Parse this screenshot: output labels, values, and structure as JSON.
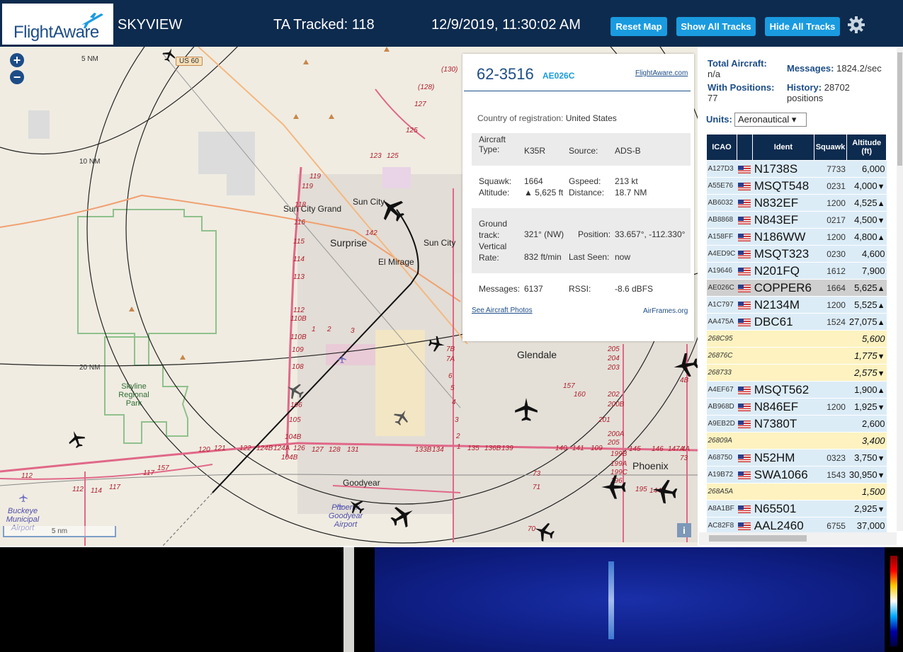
{
  "header": {
    "logo": "FlightAware",
    "app_name": "SKYVIEW",
    "tracked": "TA Tracked: 118",
    "datetime": "12/9/2019, 11:30:02 AM",
    "buttons": {
      "reset_map": "Reset Map",
      "show_all": "Show All Tracks",
      "hide_all": "Hide All Tracks"
    },
    "settings_icon": "gear-icon"
  },
  "map": {
    "zoom_in": "+",
    "zoom_out": "−",
    "range_rings": [
      "5 NM",
      "10 NM",
      "20 NM"
    ],
    "shield_us60": "US 60",
    "cities": [
      "Sun City Grand",
      "Sun City",
      "Surprise",
      "Sun City",
      "El Mirage",
      "Glendale",
      "Goodyear",
      "Phoenix"
    ],
    "park": "Skyline Regional Park",
    "airports": {
      "buckeye": "Buckeye Municipal Airport",
      "goodyear": "Phoenix Goodyear Airport"
    },
    "route_numbers": [
      "(130)",
      "(128)",
      "127",
      "125",
      "123",
      "125",
      "119",
      "119",
      "118",
      "116",
      "115",
      "114",
      "113",
      "112",
      "110B",
      "110B",
      "109",
      "108",
      "106",
      "105",
      "104B",
      "104B",
      "142",
      "1",
      "2",
      "3",
      "7B",
      "7A",
      "6",
      "5",
      "4",
      "3",
      "2",
      "1",
      "120",
      "121",
      "122",
      "124B",
      "124A",
      "126",
      "127",
      "128",
      "131",
      "133B",
      "134",
      "135",
      "136B",
      "139",
      "140",
      "141",
      "109",
      "112",
      "112",
      "114",
      "117",
      "117",
      "157",
      "157",
      "160",
      "201",
      "200A",
      "205",
      "205",
      "204",
      "203",
      "202",
      "200B",
      "199B",
      "199A",
      "199C",
      "196",
      "195",
      "144B",
      "145",
      "146",
      "147A",
      "4A",
      "4B",
      "73",
      "73",
      "71",
      "70"
    ],
    "scale": "5 nm",
    "info": "i"
  },
  "popup": {
    "registration": "62-3516",
    "icao": "AE026C",
    "link": "FlightAware.com",
    "country_label": "Country of registration:",
    "country_value": "United States",
    "aircraft_type_label_1": "Aircraft",
    "aircraft_type_label_2": "Type:",
    "aircraft_type_value": "K35R",
    "source_label": "Source:",
    "source_value": "ADS-B",
    "squawk_label": "Squawk:",
    "squawk_value": "1664",
    "gspeed_label": "Gspeed:",
    "gspeed_value": "213 kt",
    "altitude_label": "Altitude:",
    "altitude_value": "▲ 5,625 ft",
    "distance_label": "Distance:",
    "distance_value": "18.7 NM",
    "track_label_1": "Ground",
    "track_label_2": "track:",
    "track_value": "321° (NW)",
    "position_label": "Position:",
    "position_value": "33.657°, -112.330°",
    "vrate_label_1": "Vertical",
    "vrate_label_2": "Rate:",
    "vrate_value": "832 ft/min",
    "lastseen_label": "Last Seen:",
    "lastseen_value": "now",
    "messages_label": "Messages:",
    "messages_value": "6137",
    "rssi_label": "RSSI:",
    "rssi_value": "-8.6 dBFS",
    "photos_link": "See Aircraft Photos",
    "airframes_link": "AirFrames.org"
  },
  "panel": {
    "total_label": "Total Aircraft:",
    "total_value": "n/a",
    "messages_label": "Messages:",
    "messages_value": "1824.2/sec",
    "positions_label": "With Positions:",
    "positions_value": "77",
    "history_label": "History:",
    "history_value": "28702",
    "history_unit": "positions",
    "units_label": "Units:",
    "units_value": "Aeronautical ▾",
    "columns": [
      "ICAO",
      "",
      "Ident",
      "Squawk",
      "Altitude (ft)"
    ],
    "rows": [
      {
        "icao": "A127D3",
        "flag": true,
        "ident": "N1738S",
        "squawk": "7733",
        "alt": "6,000",
        "trend": "",
        "type": "adsb"
      },
      {
        "icao": "A55E76",
        "flag": true,
        "ident": "MSQT548",
        "squawk": "0231",
        "alt": "4,000",
        "trend": "▼",
        "type": "adsb"
      },
      {
        "icao": "AB6032",
        "flag": true,
        "ident": "N832EF",
        "squawk": "1200",
        "alt": "4,525",
        "trend": "▲",
        "type": "adsb"
      },
      {
        "icao": "AB8868",
        "flag": true,
        "ident": "N843EF",
        "squawk": "0217",
        "alt": "4,500",
        "trend": "▼",
        "type": "adsb"
      },
      {
        "icao": "A158FF",
        "flag": true,
        "ident": "N186WW",
        "squawk": "1200",
        "alt": "4,800",
        "trend": "▲",
        "type": "adsb"
      },
      {
        "icao": "A4ED9C",
        "flag": true,
        "ident": "MSQT323",
        "squawk": "0230",
        "alt": "4,600",
        "trend": "",
        "type": "adsb"
      },
      {
        "icao": "A19646",
        "flag": true,
        "ident": "N201FQ",
        "squawk": "1612",
        "alt": "7,900",
        "trend": "",
        "type": "adsb"
      },
      {
        "icao": "AE026C",
        "flag": true,
        "ident": "COPPER6",
        "squawk": "1664",
        "alt": "5,625",
        "trend": "▲",
        "type": "sel"
      },
      {
        "icao": "A1C797",
        "flag": true,
        "ident": "N2134M",
        "squawk": "1200",
        "alt": "5,525",
        "trend": "▲",
        "type": "adsb"
      },
      {
        "icao": "AA475A",
        "flag": true,
        "ident": "DBC61",
        "squawk": "1524",
        "alt": "27,075",
        "trend": "▲",
        "type": "adsb"
      },
      {
        "icao": "268C95",
        "flag": false,
        "ident": "",
        "squawk": "",
        "alt": "5,600",
        "trend": "",
        "type": "mlat"
      },
      {
        "icao": "26876C",
        "flag": false,
        "ident": "",
        "squawk": "",
        "alt": "1,775",
        "trend": "▼",
        "type": "mlat"
      },
      {
        "icao": "268733",
        "flag": false,
        "ident": "",
        "squawk": "",
        "alt": "2,575",
        "trend": "▼",
        "type": "mlat"
      },
      {
        "icao": "A4EF67",
        "flag": true,
        "ident": "MSQT562",
        "squawk": "",
        "alt": "1,900",
        "trend": "▲",
        "type": "adsb"
      },
      {
        "icao": "AB968D",
        "flag": true,
        "ident": "N846EF",
        "squawk": "1200",
        "alt": "1,925",
        "trend": "▼",
        "type": "adsb"
      },
      {
        "icao": "A9EB2D",
        "flag": true,
        "ident": "N7380T",
        "squawk": "",
        "alt": "2,600",
        "trend": "",
        "type": "adsb"
      },
      {
        "icao": "26809A",
        "flag": false,
        "ident": "",
        "squawk": "",
        "alt": "3,400",
        "trend": "",
        "type": "mlat"
      },
      {
        "icao": "A68750",
        "flag": true,
        "ident": "N52HM",
        "squawk": "0323",
        "alt": "3,750",
        "trend": "▼",
        "type": "adsb"
      },
      {
        "icao": "A19B72",
        "flag": true,
        "ident": "SWA1066",
        "squawk": "1543",
        "alt": "30,950",
        "trend": "▼",
        "type": "adsb"
      },
      {
        "icao": "268A5A",
        "flag": false,
        "ident": "",
        "squawk": "",
        "alt": "1,500",
        "trend": "",
        "type": "mlat"
      },
      {
        "icao": "A8A1BF",
        "flag": true,
        "ident": "N65501",
        "squawk": "",
        "alt": "2,925",
        "trend": "▼",
        "type": "adsb"
      },
      {
        "icao": "AC82F8",
        "flag": true,
        "ident": "AAL2460",
        "squawk": "6755",
        "alt": "37,000",
        "trend": "",
        "type": "adsb"
      }
    ]
  }
}
